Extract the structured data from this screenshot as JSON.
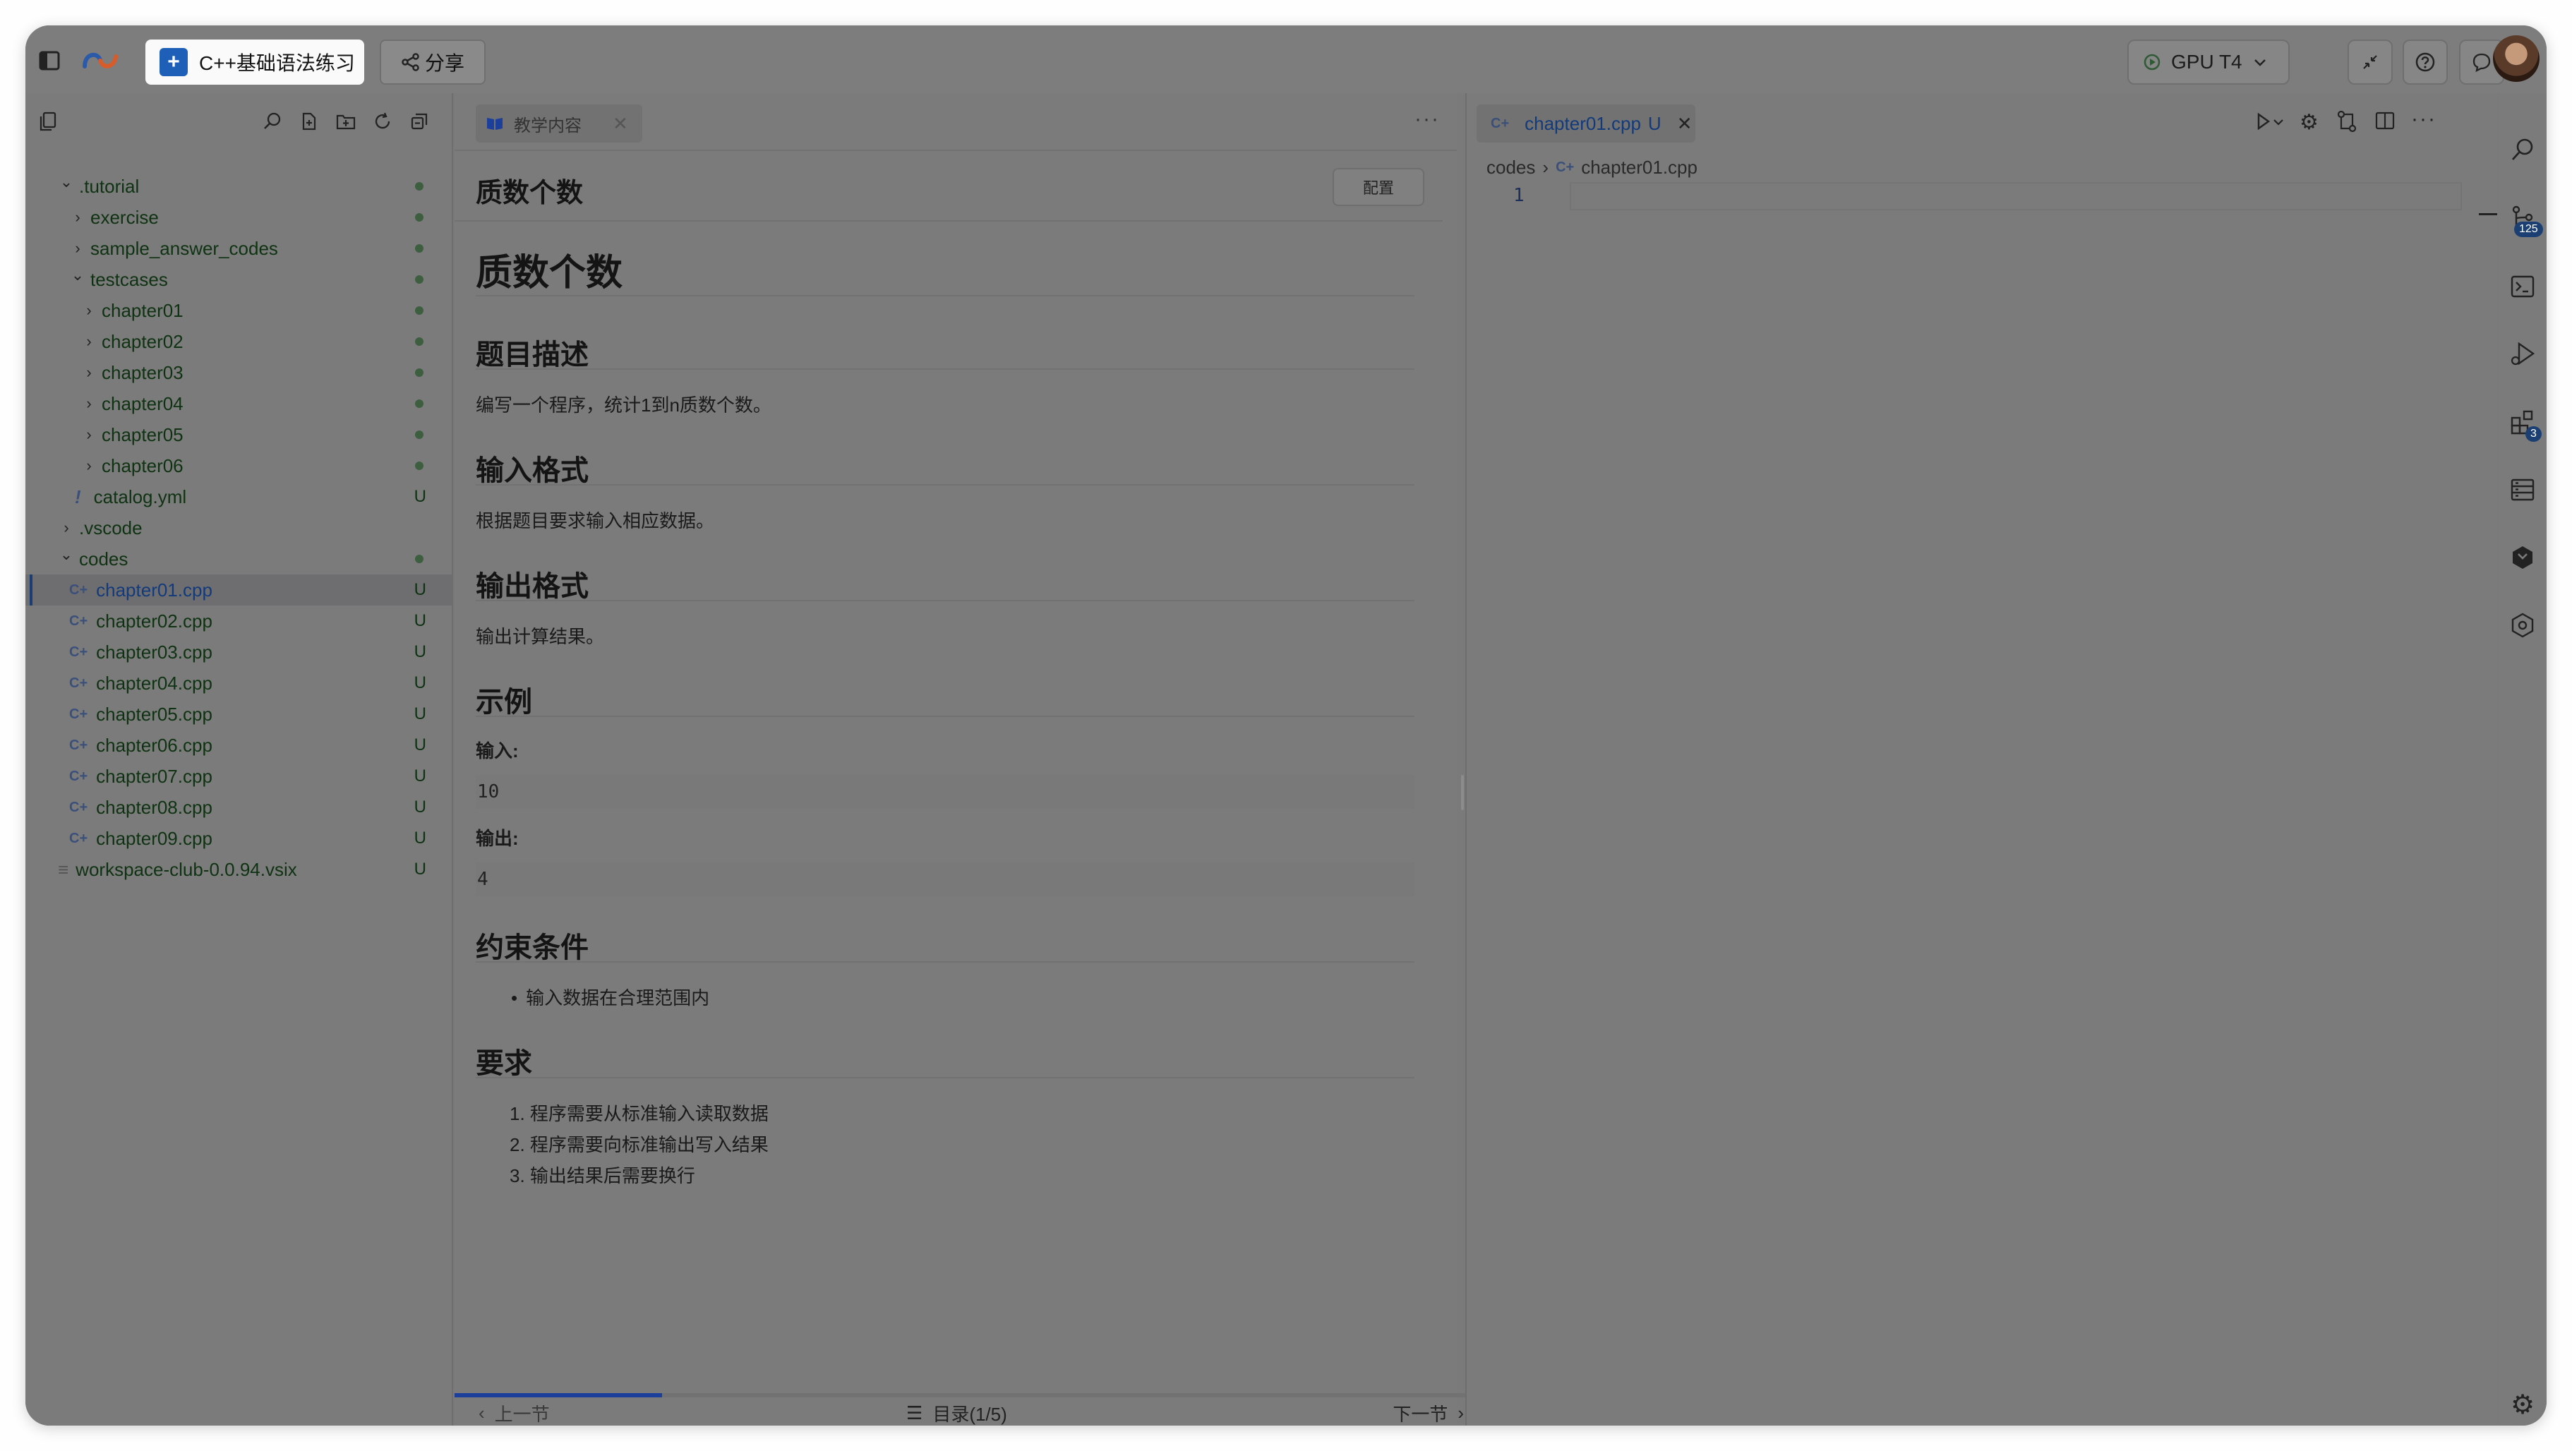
{
  "topbar": {
    "course_title": "C++基础语法练习",
    "course_logo": "+",
    "share_label": "分享",
    "gpu_label": "GPU T4"
  },
  "explorer": {
    "items": [
      {
        "label": ".tutorial",
        "indent": 0,
        "expanded": true,
        "kind": "folder",
        "status": "dot"
      },
      {
        "label": "exercise",
        "indent": 1,
        "expanded": false,
        "kind": "folder",
        "status": "dot"
      },
      {
        "label": "sample_answer_codes",
        "indent": 1,
        "expanded": false,
        "kind": "folder",
        "status": "dot"
      },
      {
        "label": "testcases",
        "indent": 1,
        "expanded": true,
        "kind": "folder",
        "status": "dot"
      },
      {
        "label": "chapter01",
        "indent": 2,
        "expanded": false,
        "kind": "folder",
        "status": "dot"
      },
      {
        "label": "chapter02",
        "indent": 2,
        "expanded": false,
        "kind": "folder",
        "status": "dot"
      },
      {
        "label": "chapter03",
        "indent": 2,
        "expanded": false,
        "kind": "folder",
        "status": "dot"
      },
      {
        "label": "chapter04",
        "indent": 2,
        "expanded": false,
        "kind": "folder",
        "status": "dot"
      },
      {
        "label": "chapter05",
        "indent": 2,
        "expanded": false,
        "kind": "folder",
        "status": "dot"
      },
      {
        "label": "chapter06",
        "indent": 2,
        "expanded": false,
        "kind": "folder",
        "status": "dot"
      },
      {
        "label": "catalog.yml",
        "indent": 1,
        "kind": "yml",
        "status": "U"
      },
      {
        "label": ".vscode",
        "indent": 0,
        "expanded": false,
        "kind": "folder",
        "status": ""
      },
      {
        "label": "codes",
        "indent": 0,
        "expanded": true,
        "kind": "folder",
        "status": "dot"
      },
      {
        "label": "chapter01.cpp",
        "indent": 1,
        "kind": "cpp",
        "status": "U",
        "selected": true
      },
      {
        "label": "chapter02.cpp",
        "indent": 1,
        "kind": "cpp",
        "status": "U"
      },
      {
        "label": "chapter03.cpp",
        "indent": 1,
        "kind": "cpp",
        "status": "U"
      },
      {
        "label": "chapter04.cpp",
        "indent": 1,
        "kind": "cpp",
        "status": "U"
      },
      {
        "label": "chapter05.cpp",
        "indent": 1,
        "kind": "cpp",
        "status": "U"
      },
      {
        "label": "chapter06.cpp",
        "indent": 1,
        "kind": "cpp",
        "status": "U"
      },
      {
        "label": "chapter07.cpp",
        "indent": 1,
        "kind": "cpp",
        "status": "U"
      },
      {
        "label": "chapter08.cpp",
        "indent": 1,
        "kind": "cpp",
        "status": "U"
      },
      {
        "label": "chapter09.cpp",
        "indent": 1,
        "kind": "cpp",
        "status": "U"
      },
      {
        "label": "workspace-club-0.0.94.vsix",
        "indent": 0,
        "kind": "vsix",
        "status": "U"
      }
    ]
  },
  "doc": {
    "tab_label": "教学内容",
    "header_title": "质数个数",
    "config_label": "配置",
    "h1": "质数个数",
    "desc_heading": "题目描述",
    "desc_text": "编写一个程序，统计1到n质数个数。",
    "input_heading": "输入格式",
    "input_text": "根据题目要求输入相应数据。",
    "output_heading": "输出格式",
    "output_text": "输出计算结果。",
    "example_heading": "示例",
    "example_input_label": "输入:",
    "example_input_value": "10",
    "example_output_label": "输出:",
    "example_output_value": "4",
    "constraint_heading": "约束条件",
    "constraint_item": "输入数据在合理范围内",
    "req_heading": "要求",
    "req_items": [
      "1. 程序需要从标准输入读取数据",
      "2. 程序需要向标准输出写入结果",
      "3. 输出结果后需要换行"
    ],
    "prev_label": "上一节",
    "toc_label": "目录(1/5)",
    "next_label": "下一节",
    "progress_fraction": 0.2
  },
  "editor": {
    "tab_label": "chapter01.cpp",
    "tab_status": "U",
    "breadcrumb_folder": "codes",
    "breadcrumb_file": "chapter01.cpp",
    "line_number": "1"
  },
  "activity": {
    "scm_badge": "125",
    "ext_badge": "3"
  },
  "colors": {
    "link_blue": "#1b3f73",
    "tree_green": "#0f3312",
    "progress": "#1b3f9a"
  }
}
